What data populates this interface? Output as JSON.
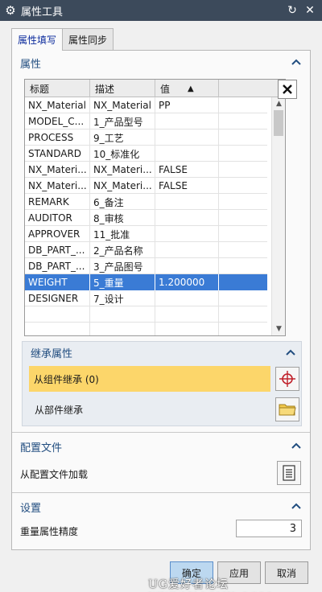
{
  "window": {
    "title": "属性工具",
    "app_icon": "gear-icon",
    "refresh_icon": "refresh-icon",
    "close_icon": "close-icon"
  },
  "tabs": [
    {
      "label": "属性填写",
      "active": true
    },
    {
      "label": "属性同步",
      "active": false
    }
  ],
  "attributes": {
    "heading": "属性",
    "columns": [
      "标题",
      "描述",
      "值"
    ],
    "sort_indicator": "▲",
    "rows": [
      {
        "title": "NX_Material",
        "desc": "NX_Material",
        "value": "PP"
      },
      {
        "title": "MODEL_C...",
        "desc": "1_产品型号",
        "value": ""
      },
      {
        "title": "PROCESS",
        "desc": "9_工艺",
        "value": ""
      },
      {
        "title": "STANDARD",
        "desc": "10_标准化",
        "value": ""
      },
      {
        "title": "NX_Materi...",
        "desc": "NX_Materi...",
        "value": "FALSE"
      },
      {
        "title": "NX_Materi...",
        "desc": "NX_Materi...",
        "value": "FALSE"
      },
      {
        "title": "REMARK",
        "desc": "6_备注",
        "value": ""
      },
      {
        "title": "AUDITOR",
        "desc": "8_审核",
        "value": ""
      },
      {
        "title": "APPROVER",
        "desc": "11_批准",
        "value": ""
      },
      {
        "title": "DB_PART_...",
        "desc": "2_产品名称",
        "value": ""
      },
      {
        "title": "DB_PART_...",
        "desc": "3_产品图号",
        "value": ""
      },
      {
        "title": "WEIGHT",
        "desc": "5_重量",
        "value": "1.200000",
        "selected": true
      },
      {
        "title": "DESIGNER",
        "desc": "7_设计",
        "value": ""
      },
      {
        "title": "",
        "desc": "",
        "value": ""
      },
      {
        "title": "",
        "desc": "",
        "value": ""
      }
    ]
  },
  "inherit": {
    "heading": "继承属性",
    "from_component": "从组件继承 (0)",
    "from_part": "从部件继承"
  },
  "config": {
    "heading": "配置文件",
    "load_label": "从配置文件加载"
  },
  "settings": {
    "heading": "设置",
    "weight_precision_label": "重量属性精度",
    "weight_precision_value": "3"
  },
  "buttons": {
    "ok": "确定",
    "apply": "应用",
    "cancel": "取消"
  },
  "watermark": "UG爱好者论坛  WWW.UGSNX.COM",
  "colors": {
    "title_bar": "#3c4a5b",
    "section_text": "#224e80",
    "selected_row": "#3a7bd5",
    "highlight": "#fcd66a"
  }
}
